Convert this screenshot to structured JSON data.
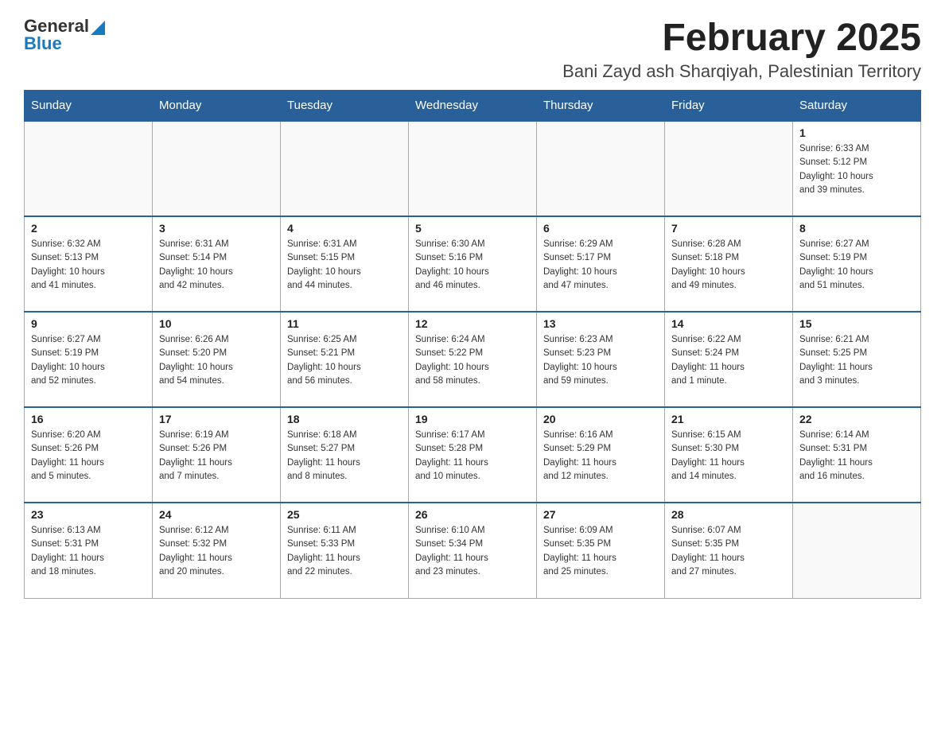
{
  "header": {
    "logo_general": "General",
    "logo_blue": "Blue",
    "month_title": "February 2025",
    "location": "Bani Zayd ash Sharqiyah, Palestinian Territory"
  },
  "weekdays": [
    "Sunday",
    "Monday",
    "Tuesday",
    "Wednesday",
    "Thursday",
    "Friday",
    "Saturday"
  ],
  "weeks": [
    [
      {
        "day": "",
        "info": ""
      },
      {
        "day": "",
        "info": ""
      },
      {
        "day": "",
        "info": ""
      },
      {
        "day": "",
        "info": ""
      },
      {
        "day": "",
        "info": ""
      },
      {
        "day": "",
        "info": ""
      },
      {
        "day": "1",
        "info": "Sunrise: 6:33 AM\nSunset: 5:12 PM\nDaylight: 10 hours\nand 39 minutes."
      }
    ],
    [
      {
        "day": "2",
        "info": "Sunrise: 6:32 AM\nSunset: 5:13 PM\nDaylight: 10 hours\nand 41 minutes."
      },
      {
        "day": "3",
        "info": "Sunrise: 6:31 AM\nSunset: 5:14 PM\nDaylight: 10 hours\nand 42 minutes."
      },
      {
        "day": "4",
        "info": "Sunrise: 6:31 AM\nSunset: 5:15 PM\nDaylight: 10 hours\nand 44 minutes."
      },
      {
        "day": "5",
        "info": "Sunrise: 6:30 AM\nSunset: 5:16 PM\nDaylight: 10 hours\nand 46 minutes."
      },
      {
        "day": "6",
        "info": "Sunrise: 6:29 AM\nSunset: 5:17 PM\nDaylight: 10 hours\nand 47 minutes."
      },
      {
        "day": "7",
        "info": "Sunrise: 6:28 AM\nSunset: 5:18 PM\nDaylight: 10 hours\nand 49 minutes."
      },
      {
        "day": "8",
        "info": "Sunrise: 6:27 AM\nSunset: 5:19 PM\nDaylight: 10 hours\nand 51 minutes."
      }
    ],
    [
      {
        "day": "9",
        "info": "Sunrise: 6:27 AM\nSunset: 5:19 PM\nDaylight: 10 hours\nand 52 minutes."
      },
      {
        "day": "10",
        "info": "Sunrise: 6:26 AM\nSunset: 5:20 PM\nDaylight: 10 hours\nand 54 minutes."
      },
      {
        "day": "11",
        "info": "Sunrise: 6:25 AM\nSunset: 5:21 PM\nDaylight: 10 hours\nand 56 minutes."
      },
      {
        "day": "12",
        "info": "Sunrise: 6:24 AM\nSunset: 5:22 PM\nDaylight: 10 hours\nand 58 minutes."
      },
      {
        "day": "13",
        "info": "Sunrise: 6:23 AM\nSunset: 5:23 PM\nDaylight: 10 hours\nand 59 minutes."
      },
      {
        "day": "14",
        "info": "Sunrise: 6:22 AM\nSunset: 5:24 PM\nDaylight: 11 hours\nand 1 minute."
      },
      {
        "day": "15",
        "info": "Sunrise: 6:21 AM\nSunset: 5:25 PM\nDaylight: 11 hours\nand 3 minutes."
      }
    ],
    [
      {
        "day": "16",
        "info": "Sunrise: 6:20 AM\nSunset: 5:26 PM\nDaylight: 11 hours\nand 5 minutes."
      },
      {
        "day": "17",
        "info": "Sunrise: 6:19 AM\nSunset: 5:26 PM\nDaylight: 11 hours\nand 7 minutes."
      },
      {
        "day": "18",
        "info": "Sunrise: 6:18 AM\nSunset: 5:27 PM\nDaylight: 11 hours\nand 8 minutes."
      },
      {
        "day": "19",
        "info": "Sunrise: 6:17 AM\nSunset: 5:28 PM\nDaylight: 11 hours\nand 10 minutes."
      },
      {
        "day": "20",
        "info": "Sunrise: 6:16 AM\nSunset: 5:29 PM\nDaylight: 11 hours\nand 12 minutes."
      },
      {
        "day": "21",
        "info": "Sunrise: 6:15 AM\nSunset: 5:30 PM\nDaylight: 11 hours\nand 14 minutes."
      },
      {
        "day": "22",
        "info": "Sunrise: 6:14 AM\nSunset: 5:31 PM\nDaylight: 11 hours\nand 16 minutes."
      }
    ],
    [
      {
        "day": "23",
        "info": "Sunrise: 6:13 AM\nSunset: 5:31 PM\nDaylight: 11 hours\nand 18 minutes."
      },
      {
        "day": "24",
        "info": "Sunrise: 6:12 AM\nSunset: 5:32 PM\nDaylight: 11 hours\nand 20 minutes."
      },
      {
        "day": "25",
        "info": "Sunrise: 6:11 AM\nSunset: 5:33 PM\nDaylight: 11 hours\nand 22 minutes."
      },
      {
        "day": "26",
        "info": "Sunrise: 6:10 AM\nSunset: 5:34 PM\nDaylight: 11 hours\nand 23 minutes."
      },
      {
        "day": "27",
        "info": "Sunrise: 6:09 AM\nSunset: 5:35 PM\nDaylight: 11 hours\nand 25 minutes."
      },
      {
        "day": "28",
        "info": "Sunrise: 6:07 AM\nSunset: 5:35 PM\nDaylight: 11 hours\nand 27 minutes."
      },
      {
        "day": "",
        "info": ""
      }
    ]
  ]
}
